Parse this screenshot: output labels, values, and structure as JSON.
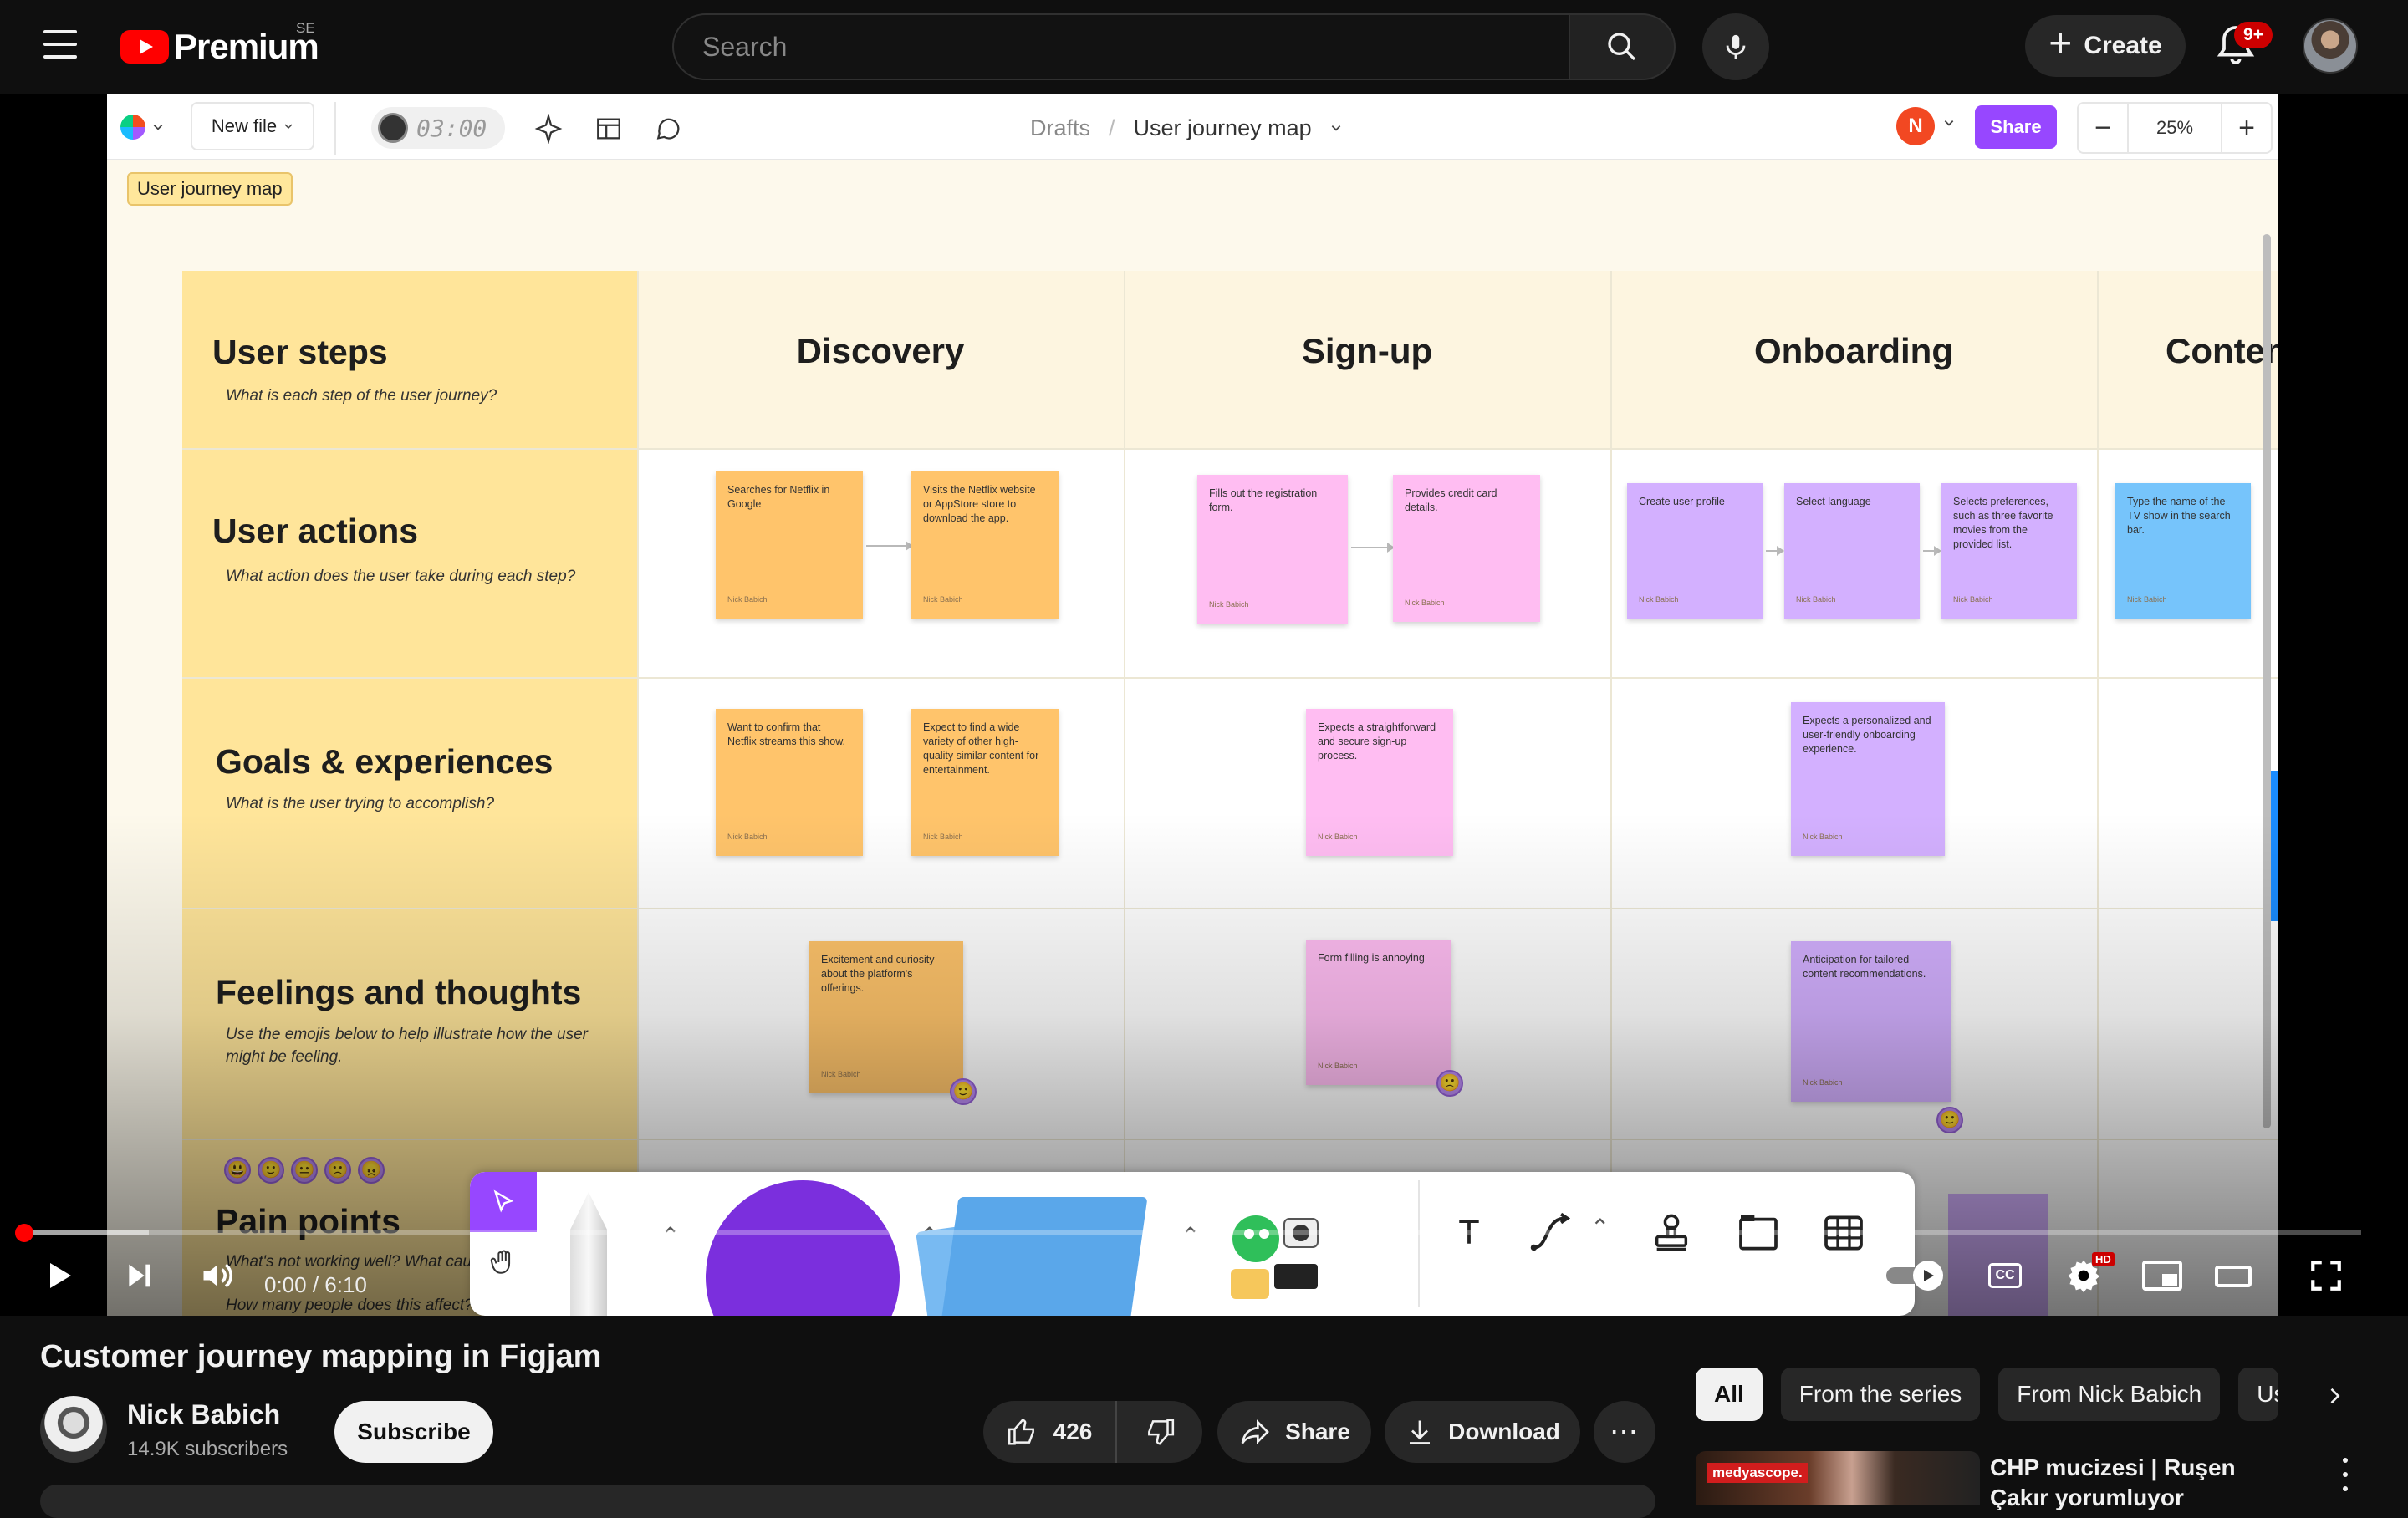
{
  "youtube": {
    "logo_text": "Premium",
    "region": "SE",
    "search_placeholder": "Search",
    "create_label": "Create",
    "notification_count": "9+"
  },
  "figjam": {
    "new_file_label": "New file",
    "timer": "03:00",
    "breadcrumb_root": "Drafts",
    "breadcrumb_sep": "/",
    "file_title": "User journey map",
    "user_initial": "N",
    "share_label": "Share",
    "zoom_minus": "−",
    "zoom_value": "25%",
    "zoom_plus": "+",
    "section_tag": "User journey map",
    "rows": [
      {
        "title": "User steps",
        "subtitle": "What is each step of the user journey?"
      },
      {
        "title": "User actions",
        "subtitle": "What action does the user take during each step?"
      },
      {
        "title": "Goals & experiences",
        "subtitle": "What is the user trying to accomplish?"
      },
      {
        "title": "Feelings and thoughts",
        "subtitle": "Use the emojis below to help illustrate how the user might be feeling."
      },
      {
        "title": "Pain points",
        "subtitle": "What's not working well? What caus",
        "subtitle2": "How many people does this affect? On a scale of"
      }
    ],
    "stages": [
      "Discovery",
      "Sign-up",
      "Onboarding",
      "Conten"
    ],
    "author": "Nick Babich",
    "stickies": {
      "d_a1": "Searches for Netflix in Google",
      "d_a2": "Visits the Netflix website or AppStore store to download the app.",
      "s_a1": "Fills out the registration form.",
      "s_a2": "Provides credit card details.",
      "o_a1": "Create user profile",
      "o_a2": "Select language",
      "o_a3": "Selects preferences, such as three favorite movies from the provided list.",
      "c_a1": "Type the name of the TV show in the search bar.",
      "d_g1": "Want to confirm that Netflix streams this show.",
      "d_g2": "Expect to find a wide variety of other high-quality similar content for entertainment.",
      "s_g1": "Expects a straightforward and secure sign-up process.",
      "o_g1": "Expects a personalized and user-friendly onboarding experience.",
      "d_f1": "Excitement and curiosity about the platform's offerings.",
      "s_f1": "Form filling is annoying",
      "o_f1": "Anticipation for tailored content recommendations."
    },
    "emojis": [
      "😃",
      "🙂",
      "😐",
      "🙁",
      "😠"
    ],
    "feeling_emojis": {
      "discovery": "🙂",
      "signup": "🙁",
      "onboarding": "🙂"
    },
    "tools": {
      "text": "T"
    }
  },
  "player": {
    "time": "0:00 / 6:10",
    "cc_label": "CC",
    "hd_badge": "HD",
    "progress": 0
  },
  "video": {
    "title": "Customer journey mapping in Figjam",
    "channel_name": "Nick Babich",
    "subscribers": "14.9K subscribers",
    "subscribe_label": "Subscribe",
    "likes": "426",
    "share_label": "Share",
    "download_label": "Download",
    "more_label": "⋯"
  },
  "sidebar": {
    "chips": [
      "All",
      "From the series",
      "From Nick Babich",
      "Us"
    ],
    "recommendation": {
      "title": "CHP mucizesi | Ruşen Çakır yorumluyor",
      "thumb_brand": "medyascope."
    }
  },
  "colors": {
    "youtube_red": "#ff0000",
    "figjam_purple": "#9747ff",
    "sticky_orange": "#ffc46b",
    "sticky_pink": "#ffbdf2",
    "sticky_purple": "#d3b0ff",
    "sticky_blue": "#76c4fb",
    "journey_yellow": "#ffe59a"
  }
}
